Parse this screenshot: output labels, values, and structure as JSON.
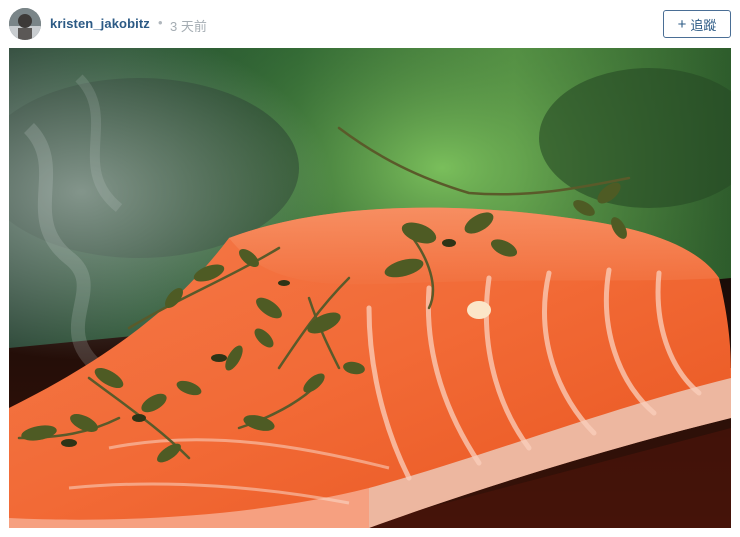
{
  "post": {
    "username": "kristen_jakobitz",
    "separator": "•",
    "time_ago": "3 天前",
    "follow_label": "追蹤",
    "follow_icon": "plus-icon"
  },
  "photo": {
    "subject": "salmon-fillet-with-thyme",
    "colors": {
      "salmon": "#f26a3a",
      "background_green": "#3f8a3a",
      "plate": "#2a0f0a"
    }
  }
}
